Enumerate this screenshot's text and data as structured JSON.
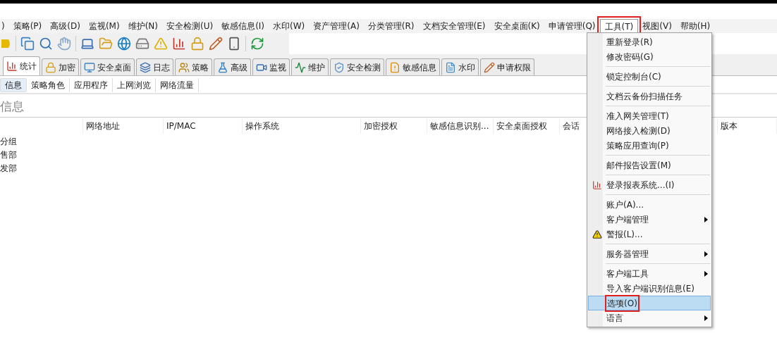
{
  "menu_bar": [
    {
      "label": ")",
      "selected": false,
      "outlined": false
    },
    {
      "label": "策略(P)",
      "selected": false,
      "outlined": false
    },
    {
      "label": "高级(D)",
      "selected": false,
      "outlined": false
    },
    {
      "label": "监视(M)",
      "selected": false,
      "outlined": false
    },
    {
      "label": "维护(N)",
      "selected": false,
      "outlined": false
    },
    {
      "label": "安全检测(U)",
      "selected": false,
      "outlined": false
    },
    {
      "label": "敏感信息(I)",
      "selected": false,
      "outlined": false
    },
    {
      "label": "水印(W)",
      "selected": false,
      "outlined": false
    },
    {
      "label": "资产管理(A)",
      "selected": false,
      "outlined": false
    },
    {
      "label": "分类管理(R)",
      "selected": false,
      "outlined": false
    },
    {
      "label": "文档安全管理(E)",
      "selected": false,
      "outlined": false
    },
    {
      "label": "安全桌面(K)",
      "selected": false,
      "outlined": false
    },
    {
      "label": "申请管理(Q)",
      "selected": false,
      "outlined": false
    },
    {
      "label": "工具(T)",
      "selected": true,
      "outlined": true
    },
    {
      "label": "视图(V)",
      "selected": false,
      "outlined": false
    },
    {
      "label": "帮助(H)",
      "selected": false,
      "outlined": false
    }
  ],
  "tabs": [
    {
      "label": "统计",
      "selected": true
    },
    {
      "label": "加密",
      "selected": false
    },
    {
      "label": "安全桌面",
      "selected": false
    },
    {
      "label": "日志",
      "selected": false
    },
    {
      "label": "策略",
      "selected": false
    },
    {
      "label": "高级",
      "selected": false
    },
    {
      "label": "监视",
      "selected": false
    },
    {
      "label": "维护",
      "selected": false
    },
    {
      "label": "安全检测",
      "selected": false
    },
    {
      "label": "敏感信息",
      "selected": false
    },
    {
      "label": "水印",
      "selected": false
    },
    {
      "label": "申请权限",
      "selected": false
    }
  ],
  "sub_tabs": [
    {
      "label": "信息",
      "selected": true
    },
    {
      "label": "策略角色",
      "selected": false
    },
    {
      "label": "应用程序",
      "selected": false
    },
    {
      "label": "上网浏览",
      "selected": false
    },
    {
      "label": "网络流量",
      "selected": false
    }
  ],
  "section_title": "信息",
  "table": {
    "columns": [
      "",
      "网络地址",
      "IP/MAC",
      "操作系统",
      "加密授权",
      "敏感信息识别...",
      "安全桌面授权",
      "会话",
      "版本"
    ],
    "rows": [
      [
        "分组"
      ],
      [
        "售部"
      ],
      [
        "发部"
      ]
    ]
  },
  "tools_menu": [
    {
      "kind": "item",
      "label": "重新登录(R)",
      "submenu": false,
      "icon": false,
      "selected": false,
      "outlined": false
    },
    {
      "kind": "item",
      "label": "修改密码(G)",
      "submenu": false,
      "icon": false,
      "selected": false,
      "outlined": false
    },
    {
      "kind": "separator"
    },
    {
      "kind": "item",
      "label": "锁定控制台(C)",
      "submenu": false,
      "icon": false,
      "selected": false,
      "outlined": false
    },
    {
      "kind": "separator"
    },
    {
      "kind": "item",
      "label": "文档云备份扫描任务",
      "submenu": false,
      "icon": false,
      "selected": false,
      "outlined": false
    },
    {
      "kind": "separator"
    },
    {
      "kind": "item",
      "label": "准入网关管理(T)",
      "submenu": false,
      "icon": false,
      "selected": false,
      "outlined": false
    },
    {
      "kind": "item",
      "label": "网络接入检测(D)",
      "submenu": false,
      "icon": false,
      "selected": false,
      "outlined": false
    },
    {
      "kind": "item",
      "label": "策略应用查询(P)",
      "submenu": false,
      "icon": false,
      "selected": false,
      "outlined": false
    },
    {
      "kind": "separator"
    },
    {
      "kind": "item",
      "label": "邮件报告设置(M)",
      "submenu": false,
      "icon": false,
      "selected": false,
      "outlined": false
    },
    {
      "kind": "separator"
    },
    {
      "kind": "item",
      "label": "登录报表系统...(I)",
      "submenu": false,
      "icon": true,
      "selected": false,
      "outlined": false
    },
    {
      "kind": "separator"
    },
    {
      "kind": "item",
      "label": "账户(A)...",
      "submenu": false,
      "icon": false,
      "selected": false,
      "outlined": false
    },
    {
      "kind": "item",
      "label": "客户端管理",
      "submenu": true,
      "icon": false,
      "selected": false,
      "outlined": false
    },
    {
      "kind": "item",
      "label": "警报(L)...",
      "submenu": false,
      "icon": true,
      "selected": false,
      "outlined": false
    },
    {
      "kind": "separator"
    },
    {
      "kind": "item",
      "label": "服务器管理",
      "submenu": true,
      "icon": false,
      "selected": false,
      "outlined": false
    },
    {
      "kind": "separator"
    },
    {
      "kind": "item",
      "label": "客户端工具",
      "submenu": true,
      "icon": false,
      "selected": false,
      "outlined": false
    },
    {
      "kind": "item",
      "label": "导入客户端识别信息(E)",
      "submenu": false,
      "icon": false,
      "selected": false,
      "outlined": false
    },
    {
      "kind": "item",
      "label": "选项(O)",
      "submenu": false,
      "icon": false,
      "selected": true,
      "outlined": true
    },
    {
      "kind": "item",
      "label": "语言",
      "submenu": true,
      "icon": false,
      "selected": false,
      "outlined": false
    }
  ]
}
